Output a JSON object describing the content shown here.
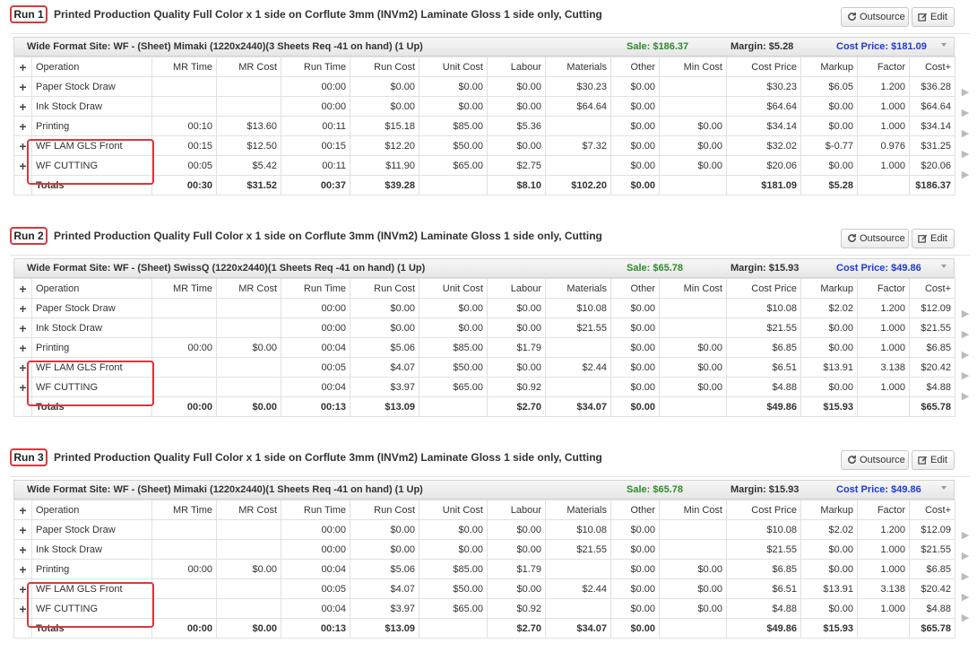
{
  "header_labels": {
    "outsource": "Outsource",
    "edit": "Edit"
  },
  "columns": [
    "Operation",
    "MR Time",
    "MR Cost",
    "Run Time",
    "Run Cost",
    "Unit Cost",
    "Labour",
    "Materials",
    "Other",
    "Min Cost",
    "Cost Price",
    "Markup",
    "Factor",
    "Cost+"
  ],
  "runs": [
    {
      "label": "Run 1",
      "title": "Printed Production Quality Full Color x 1 side on Corflute 3mm (INVm2) Laminate Gloss 1 side only, Cutting",
      "site": "Wide Format Site: WF - (Sheet) Mimaki (1220x2440)(3 Sheets Req -41 on hand) (1 Up)",
      "sale": "Sale: $186.37",
      "margin": "Margin: $5.28",
      "cost_price": "Cost Price: $181.09",
      "rows": [
        [
          "Paper Stock Draw",
          "",
          "",
          "00:00",
          "$0.00",
          "$0.00",
          "$0.00",
          "$30.23",
          "$0.00",
          "",
          "$30.23",
          "$6.05",
          "1.200",
          "$36.28"
        ],
        [
          "Ink Stock Draw",
          "",
          "",
          "00:00",
          "$0.00",
          "$0.00",
          "$0.00",
          "$64.64",
          "$0.00",
          "",
          "$64.64",
          "$0.00",
          "1.000",
          "$64.64"
        ],
        [
          "Printing",
          "00:10",
          "$13.60",
          "00:11",
          "$15.18",
          "$85.00",
          "$5.36",
          "",
          "$0.00",
          "$0.00",
          "$34.14",
          "$0.00",
          "1.000",
          "$34.14"
        ],
        [
          "WF LAM GLS Front",
          "00:15",
          "$12.50",
          "00:15",
          "$12.20",
          "$50.00",
          "$0.00",
          "$7.32",
          "$0.00",
          "$0.00",
          "$32.02",
          "$-0.77",
          "0.976",
          "$31.25"
        ],
        [
          "WF CUTTING",
          "00:05",
          "$5.42",
          "00:11",
          "$11.90",
          "$65.00",
          "$2.75",
          "",
          "$0.00",
          "$0.00",
          "$20.06",
          "$0.00",
          "1.000",
          "$20.06"
        ]
      ],
      "totals": [
        "Totals",
        "00:30",
        "$31.52",
        "00:37",
        "$39.28",
        "",
        "$8.10",
        "$102.20",
        "$0.00",
        "",
        "$181.09",
        "$5.28",
        "",
        "$186.37"
      ]
    },
    {
      "label": "Run 2",
      "title": "Printed Production Quality Full Color x 1 side on Corflute 3mm (INVm2) Laminate Gloss 1 side only, Cutting",
      "site": "Wide Format Site: WF - (Sheet) SwissQ (1220x2440)(1 Sheets Req -41 on hand) (1 Up)",
      "sale": "Sale: $65.78",
      "margin": "Margin: $15.93",
      "cost_price": "Cost Price: $49.86",
      "rows": [
        [
          "Paper Stock Draw",
          "",
          "",
          "00:00",
          "$0.00",
          "$0.00",
          "$0.00",
          "$10.08",
          "$0.00",
          "",
          "$10.08",
          "$2.02",
          "1.200",
          "$12.09"
        ],
        [
          "Ink Stock Draw",
          "",
          "",
          "00:00",
          "$0.00",
          "$0.00",
          "$0.00",
          "$21.55",
          "$0.00",
          "",
          "$21.55",
          "$0.00",
          "1.000",
          "$21.55"
        ],
        [
          "Printing",
          "00:00",
          "$0.00",
          "00:04",
          "$5.06",
          "$85.00",
          "$1.79",
          "",
          "$0.00",
          "$0.00",
          "$6.85",
          "$0.00",
          "1.000",
          "$6.85"
        ],
        [
          "WF LAM GLS Front",
          "",
          "",
          "00:05",
          "$4.07",
          "$50.00",
          "$0.00",
          "$2.44",
          "$0.00",
          "$0.00",
          "$6.51",
          "$13.91",
          "3.138",
          "$20.42"
        ],
        [
          "WF CUTTING",
          "",
          "",
          "00:04",
          "$3.97",
          "$65.00",
          "$0.92",
          "",
          "$0.00",
          "$0.00",
          "$4.88",
          "$0.00",
          "1.000",
          "$4.88"
        ]
      ],
      "totals": [
        "Totals",
        "00:00",
        "$0.00",
        "00:13",
        "$13.09",
        "",
        "$2.70",
        "$34.07",
        "$0.00",
        "",
        "$49.86",
        "$15.93",
        "",
        "$65.78"
      ]
    },
    {
      "label": "Run 3",
      "title": "Printed Production Quality Full Color x 1 side on Corflute 3mm (INVm2) Laminate Gloss 1 side only, Cutting",
      "site": "Wide Format Site: WF - (Sheet) Mimaki (1220x2440)(1 Sheets Req -41 on hand) (1 Up)",
      "sale": "Sale: $65.78",
      "margin": "Margin: $15.93",
      "cost_price": "Cost Price: $49.86",
      "rows": [
        [
          "Paper Stock Draw",
          "",
          "",
          "00:00",
          "$0.00",
          "$0.00",
          "$0.00",
          "$10.08",
          "$0.00",
          "",
          "$10.08",
          "$2.02",
          "1.200",
          "$12.09"
        ],
        [
          "Ink Stock Draw",
          "",
          "",
          "00:00",
          "$0.00",
          "$0.00",
          "$0.00",
          "$21.55",
          "$0.00",
          "",
          "$21.55",
          "$0.00",
          "1.000",
          "$21.55"
        ],
        [
          "Printing",
          "00:00",
          "$0.00",
          "00:04",
          "$5.06",
          "$85.00",
          "$1.79",
          "",
          "$0.00",
          "$0.00",
          "$6.85",
          "$0.00",
          "1.000",
          "$6.85"
        ],
        [
          "WF LAM GLS Front",
          "",
          "",
          "00:05",
          "$4.07",
          "$50.00",
          "$0.00",
          "$2.44",
          "$0.00",
          "$0.00",
          "$6.51",
          "$13.91",
          "3.138",
          "$20.42"
        ],
        [
          "WF CUTTING",
          "",
          "",
          "00:04",
          "$3.97",
          "$65.00",
          "$0.92",
          "",
          "$0.00",
          "$0.00",
          "$4.88",
          "$0.00",
          "1.000",
          "$4.88"
        ]
      ],
      "totals": [
        "Totals",
        "00:00",
        "$0.00",
        "00:13",
        "$13.09",
        "",
        "$2.70",
        "$34.07",
        "$0.00",
        "",
        "$49.86",
        "$15.93",
        "",
        "$65.78"
      ]
    }
  ]
}
